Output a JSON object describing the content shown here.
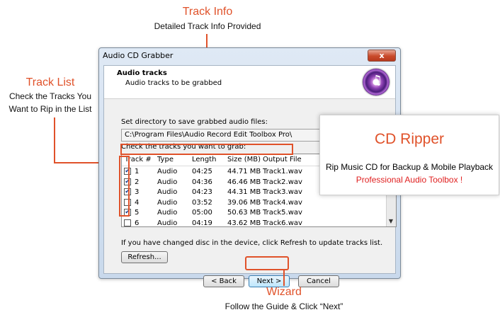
{
  "callouts": {
    "track_info": {
      "title": "Track Info",
      "desc": "Detailed Track Info Provided"
    },
    "track_list": {
      "title": "Track List",
      "desc_line1": "Check the Tracks You",
      "desc_line2": "Want to Rip in the List"
    },
    "wizard": {
      "title": "Wizard",
      "desc": "Follow the Guide & Click “Next”"
    }
  },
  "window": {
    "title": "Audio CD Grabber",
    "close_label": "x",
    "header": {
      "title": "Audio tracks",
      "subtitle": "Audio tracks to be grabbed"
    },
    "directory_label": "Set directory to save grabbed audio files:",
    "directory_value": "C:\\Program Files\\Audio Record Edit Toolbox Pro\\",
    "browse_label": "...",
    "tracks_label": "Check the tracks you want to grab:",
    "columns": [
      "Track #",
      "Type",
      "Length",
      "Size (MB)",
      "Output File"
    ],
    "tracks": [
      {
        "num": "1",
        "type": "Audio",
        "length": "04:25",
        "size": "44.71 MB",
        "file": "Track1.wav",
        "checked": true
      },
      {
        "num": "2",
        "type": "Audio",
        "length": "04:36",
        "size": "46.46 MB",
        "file": "Track2.wav",
        "checked": true
      },
      {
        "num": "3",
        "type": "Audio",
        "length": "04:23",
        "size": "44.31 MB",
        "file": "Track3.wav",
        "checked": true
      },
      {
        "num": "4",
        "type": "Audio",
        "length": "03:52",
        "size": "39.06 MB",
        "file": "Track4.wav",
        "checked": false
      },
      {
        "num": "5",
        "type": "Audio",
        "length": "05:00",
        "size": "50.63 MB",
        "file": "Track5.wav",
        "checked": true
      },
      {
        "num": "6",
        "type": "Audio",
        "length": "04:19",
        "size": "43.62 MB",
        "file": "Track6.wav",
        "checked": false
      }
    ],
    "refresh_hint": "If you have changed disc in the device, click Refresh to update tracks list.",
    "refresh_label": "Refresh...",
    "back_label": "< Back",
    "next_label": "Next >",
    "cancel_label": "Cancel"
  },
  "promo": {
    "title": "CD Ripper",
    "line1": "Rip Music CD for Backup & Mobile Playback",
    "line2": "Professional Audio Toolbox !"
  },
  "colors": {
    "accent": "#e0522a",
    "promo_red": "#e02020"
  }
}
